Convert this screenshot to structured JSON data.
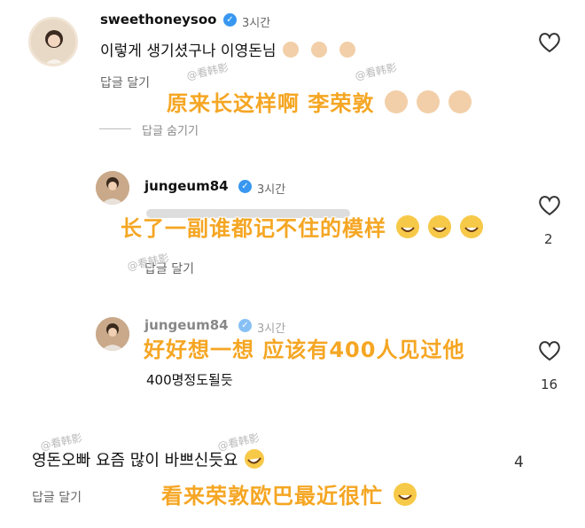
{
  "comments": [
    {
      "username": "sweethoneysoo",
      "time": "3시간",
      "text": "이렇게 생기셨구나 이영돈님",
      "reply_label": "답글 달기",
      "hide_replies_label": "답글 숨기기",
      "overlay": "原来长这样啊  李荣敦"
    },
    {
      "username": "jungeum84",
      "time": "3시간",
      "overlay": "长了一副谁都记不住的模样",
      "reply_label": "답글 달기",
      "likes": "2"
    },
    {
      "username": "jungeum84",
      "time": "3시간",
      "text": "400명정도될듯",
      "overlay": "好好想一想  应该有400人见过他",
      "likes": "16"
    },
    {
      "text": "영돈오빠 요즘 많이 바쁘신듯요",
      "reply_label": "답글 달기",
      "overlay": "看来荣敦欧巴最近很忙",
      "likes": "4"
    }
  ],
  "watermark": "@看韩影",
  "colors": {
    "overlay": "#f5a623",
    "verified": "#3897f0"
  }
}
